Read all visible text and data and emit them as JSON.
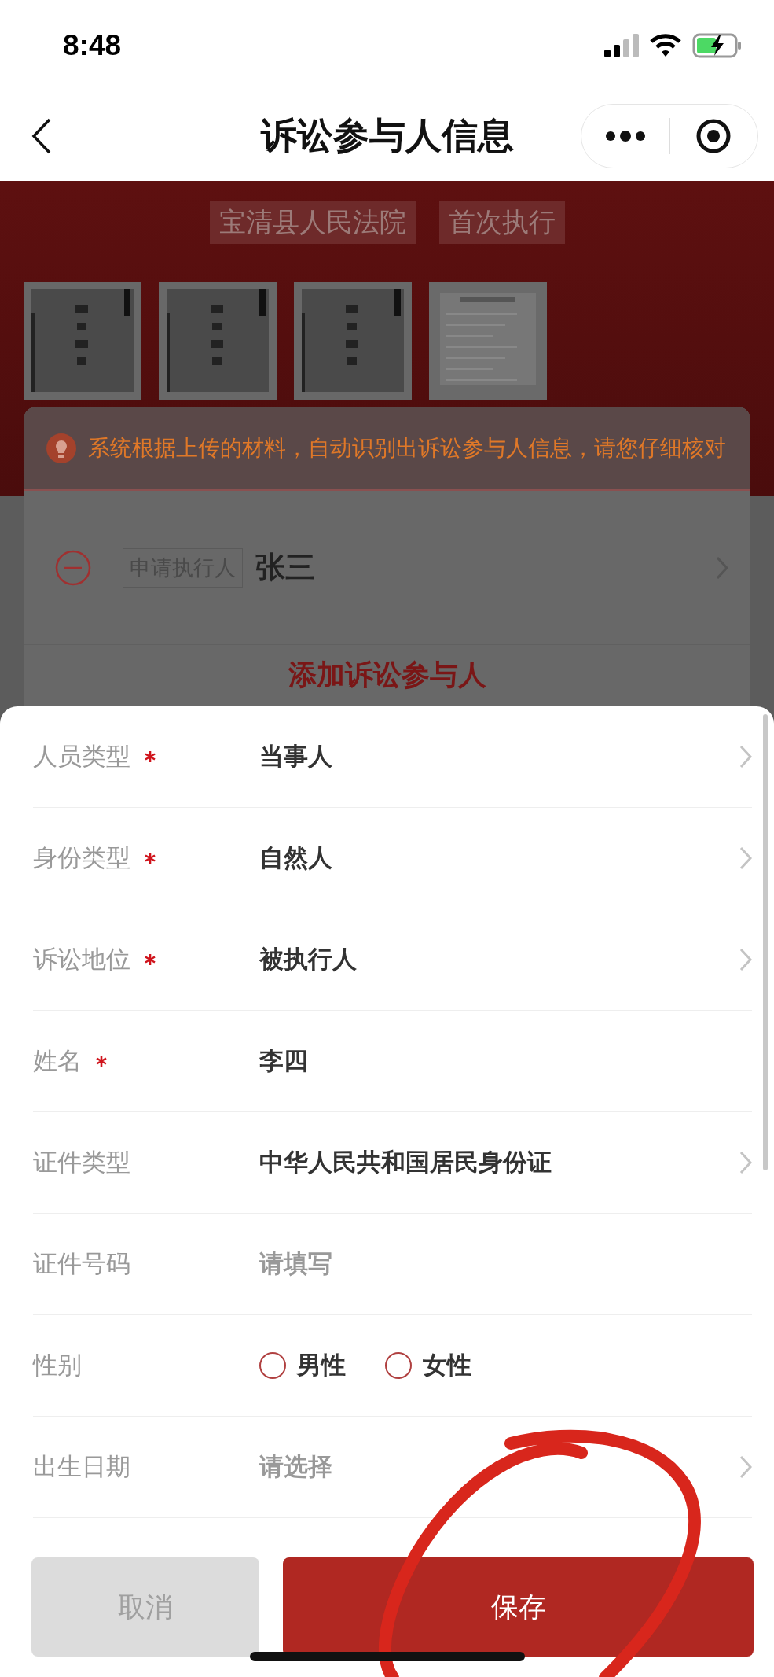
{
  "status_bar": {
    "time": "8:48"
  },
  "nav": {
    "title": "诉讼参与人信息"
  },
  "header": {
    "tags": [
      "宝清县人民法院",
      "首次执行"
    ]
  },
  "notice": {
    "text": "系统根据上传的材料，自动识别出诉讼参与人信息，请您仔细核对"
  },
  "participants": [
    {
      "role": "申请执行人",
      "name": "张三"
    }
  ],
  "add_link": "添加诉讼参与人",
  "form": {
    "fields": [
      {
        "kind": "select",
        "label": "人员类型",
        "required": true,
        "value": "当事人"
      },
      {
        "kind": "select",
        "label": "身份类型",
        "required": true,
        "value": "自然人"
      },
      {
        "kind": "select",
        "label": "诉讼地位",
        "required": true,
        "value": "被执行人"
      },
      {
        "kind": "input",
        "label": "姓名",
        "required": true,
        "value": "李四"
      },
      {
        "kind": "select",
        "label": "证件类型",
        "required": false,
        "value": "中华人民共和国居民身份证"
      },
      {
        "kind": "input",
        "label": "证件号码",
        "required": false,
        "placeholder": "请填写"
      },
      {
        "kind": "radio",
        "label": "性别",
        "required": false,
        "options": [
          {
            "label": "男性",
            "selected": false
          },
          {
            "label": "女性",
            "selected": false
          }
        ]
      },
      {
        "kind": "select",
        "label": "出生日期",
        "required": false,
        "placeholder": "请选择"
      }
    ]
  },
  "buttons": [
    {
      "label": "取消",
      "kind": "secondary"
    },
    {
      "label": "保存",
      "kind": "primary"
    }
  ]
}
